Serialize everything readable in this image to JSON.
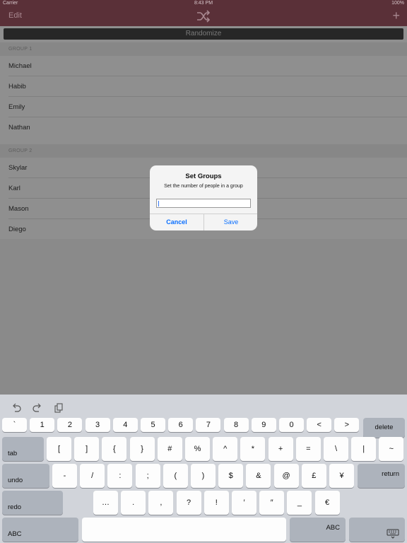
{
  "status_bar": {
    "carrier": "Carrier",
    "time": "8:43 PM",
    "battery": "100%"
  },
  "nav": {
    "edit_label": "Edit",
    "shuffle_icon": "shuffle-icon",
    "add_label": "+"
  },
  "content": {
    "randomize_label": "Randomize",
    "group1": {
      "header": "GROUP 1",
      "members": [
        "Michael",
        "Habib",
        "Emily",
        "Nathan"
      ]
    },
    "group2": {
      "header": "GROUP 2",
      "members": [
        "Skylar",
        "Karl",
        "Mason",
        "Diego"
      ]
    }
  },
  "alert": {
    "title": "Set Groups",
    "message": "Set the number of people in a group",
    "input_value": "",
    "cancel_label": "Cancel",
    "save_label": "Save"
  },
  "keyboard": {
    "row1": [
      "`",
      "1",
      "2",
      "3",
      "4",
      "5",
      "6",
      "7",
      "8",
      "9",
      "0",
      "<",
      ">"
    ],
    "delete_label": "delete",
    "tab_label": "tab",
    "row2": [
      "[",
      "]",
      "{",
      "}",
      "#",
      "%",
      "^",
      "*",
      "+",
      "=",
      "\\",
      "|",
      "~"
    ],
    "undo_label": "undo",
    "row3": [
      "-",
      "/",
      ":",
      ";",
      "(",
      ")",
      "$",
      "&",
      "@",
      "£",
      "¥"
    ],
    "return_label": "return",
    "redo_label": "redo",
    "row4": [
      "…",
      ".",
      ",",
      "?",
      "!",
      "′",
      "″",
      "_",
      "€"
    ],
    "abc_label": "ABC",
    "abc_right_label": "ABC"
  },
  "colors": {
    "nav_bg": "#5a3038",
    "accent": "#0a6fff",
    "keyboard_bg": "#d1d4da"
  }
}
